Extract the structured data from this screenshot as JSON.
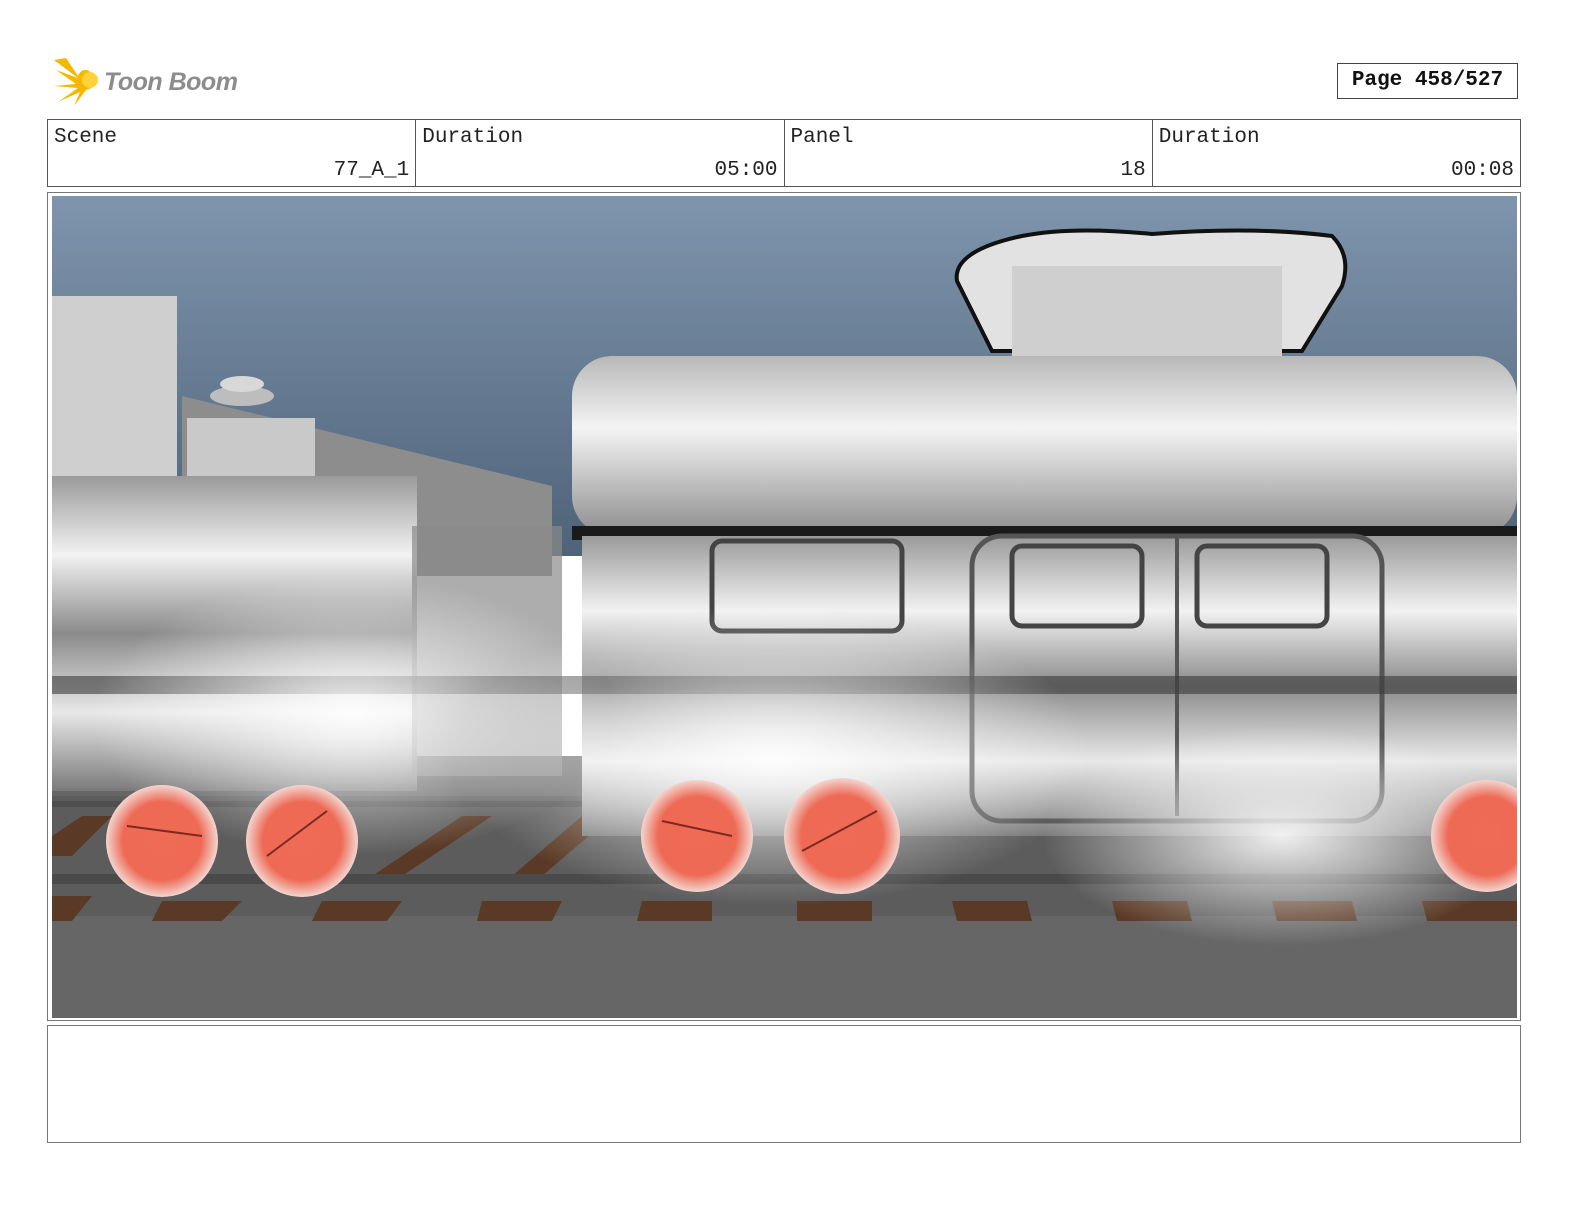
{
  "logo": {
    "text": "Toon Boom",
    "icon": "toon-boom-star-icon",
    "color": "#f5b800"
  },
  "page": {
    "label": "Page 458/527"
  },
  "header": {
    "scene_label": "Scene",
    "scene_value": "77_A_1",
    "scene_duration_label": "Duration",
    "scene_duration_value": "05:00",
    "panel_label": "Panel",
    "panel_value": "18",
    "panel_duration_label": "Duration",
    "panel_duration_value": "00:08"
  },
  "panel": {
    "image": "steam-train-passing-illustration"
  },
  "notes": {
    "text": ""
  }
}
